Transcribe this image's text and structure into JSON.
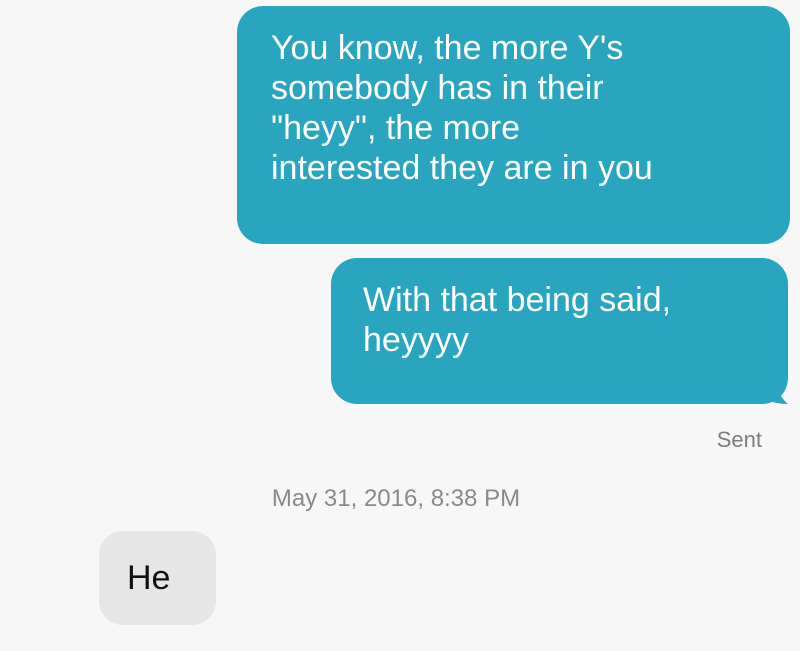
{
  "messages": {
    "outgoing": [
      {
        "text": "You know, the more Y's\nsomebody has in their\n\"heyy\", the more\ninterested they are in you"
      },
      {
        "text": "With that being said,\nheyyyy"
      }
    ],
    "status": "Sent",
    "timestamp": "May 31, 2016, 8:38 PM",
    "incoming": [
      {
        "text": "He"
      }
    ]
  },
  "colors": {
    "outgoing_bubble": "#2aa5bf",
    "incoming_bubble": "#e6e6e6",
    "background": "#f7f7f7",
    "meta_text": "#8a8a8a"
  }
}
